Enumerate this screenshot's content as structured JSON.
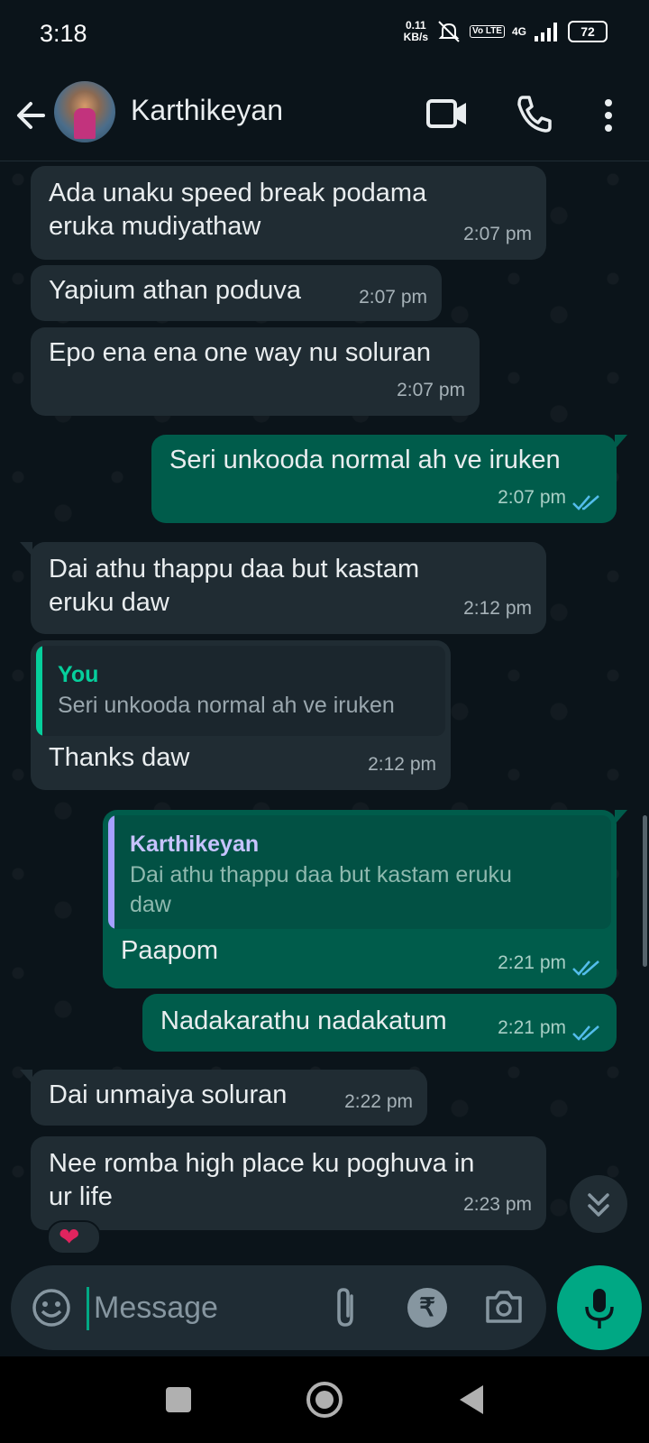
{
  "status": {
    "time": "3:18",
    "speed_value": "0.11",
    "speed_unit": "KB/s",
    "volte": "Vo LTE",
    "network": "4G",
    "battery": "72"
  },
  "header": {
    "contact_name": "Karthikeyan",
    "back_icon": "arrow-left-icon",
    "video_icon": "video-camera-icon",
    "call_icon": "phone-icon",
    "menu_icon": "more-vertical-icon"
  },
  "messages": [
    {
      "dir": "in",
      "line1": "Ada unaku speed break podama",
      "line2": "eruka mudiyathaw",
      "time": "2:07 pm"
    },
    {
      "dir": "in",
      "text": "Yapium athan poduva",
      "time": "2:07 pm"
    },
    {
      "dir": "in",
      "text": "Epo ena ena one way nu soluran",
      "time": "2:07 pm"
    },
    {
      "dir": "out",
      "text": "Seri unkooda normal ah ve iruken",
      "time": "2:07 pm",
      "status": "read"
    },
    {
      "dir": "in",
      "line1": "Dai athu thappu daa but kastam",
      "line2": "eruku daw",
      "time": "2:12 pm"
    },
    {
      "dir": "in",
      "reply_author": "You",
      "reply_text": "Seri unkooda normal ah ve iruken",
      "text": "Thanks daw",
      "time": "2:12 pm"
    },
    {
      "dir": "out",
      "reply_author": "Karthikeyan",
      "reply_line1": "Dai athu thappu daa but kastam eruku",
      "reply_line2": "daw",
      "text": "Paapom",
      "time": "2:21 pm",
      "status": "read"
    },
    {
      "dir": "out",
      "text": "Nadakarathu nadakatum",
      "time": "2:21 pm",
      "status": "read"
    },
    {
      "dir": "in",
      "text": "Dai unmaiya soluran",
      "time": "2:22 pm"
    },
    {
      "dir": "in",
      "line1": "Nee romba high place ku poghuva in",
      "line2": "ur life",
      "time": "2:23 pm",
      "reaction": "❤"
    }
  ],
  "composer": {
    "placeholder": "Message",
    "rupee_symbol": "₹",
    "icons": [
      "emoji-icon",
      "attach-icon",
      "rupee-payment-icon",
      "camera-icon",
      "microphone-icon"
    ]
  },
  "colors": {
    "background": "#0b141a",
    "incoming_bubble": "#202c33",
    "outgoing_bubble": "#005c4b",
    "accent": "#00a884",
    "read_ticks": "#53bdeb",
    "you_quote": "#06cf9c",
    "contact_quote": "#a5a0ff"
  }
}
